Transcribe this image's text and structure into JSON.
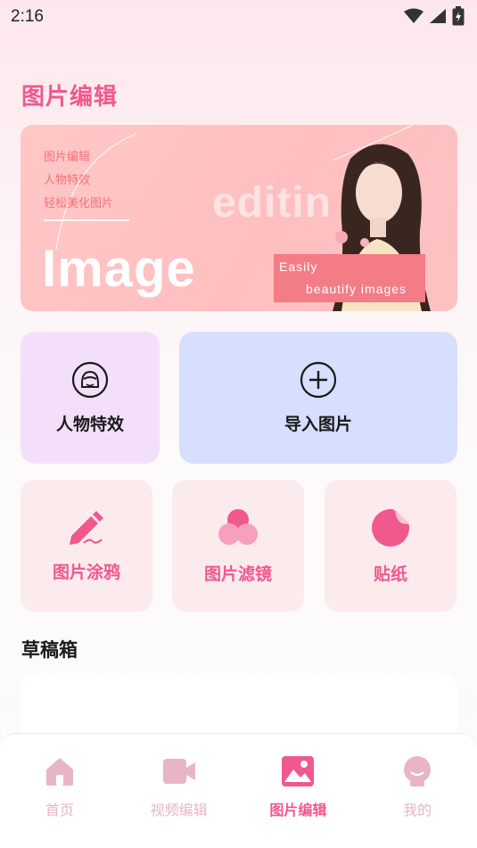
{
  "status": {
    "time": "2:16",
    "icons": [
      "wifi-icon",
      "signal-icon",
      "battery-icon"
    ]
  },
  "page": {
    "title": "图片编辑"
  },
  "banner": {
    "lines": [
      "图片编辑",
      "人物特效",
      "轻松美化图片"
    ],
    "big_text": "Image",
    "faint_text": "editin",
    "tag_line1": "Easily",
    "tag_line2": "beautify images"
  },
  "features": {
    "person_effects": {
      "label": "人物特效",
      "icon": "face-icon"
    },
    "import_image": {
      "label": "导入图片",
      "icon": "plus-circle-icon"
    },
    "doodle": {
      "label": "图片涂鸦",
      "icon": "pencil-icon"
    },
    "filter": {
      "label": "图片滤镜",
      "icon": "filter-circles-icon"
    },
    "sticker": {
      "label": "贴纸",
      "icon": "sticker-icon"
    }
  },
  "drafts": {
    "title": "草稿箱"
  },
  "tabbar": {
    "items": [
      {
        "label": "首页",
        "icon": "home-icon"
      },
      {
        "label": "视频编辑",
        "icon": "video-icon"
      },
      {
        "label": "图片编辑",
        "icon": "image-icon",
        "active": true
      },
      {
        "label": "我的",
        "icon": "profile-icon"
      }
    ]
  },
  "colors": {
    "accent": "#f0588e",
    "banner": "#ffc3c4",
    "purple_card": "#f4dffb",
    "blue_card": "#d6dffd",
    "pink_card": "#fcebec",
    "tab_inactive": "#e7b5c3"
  }
}
